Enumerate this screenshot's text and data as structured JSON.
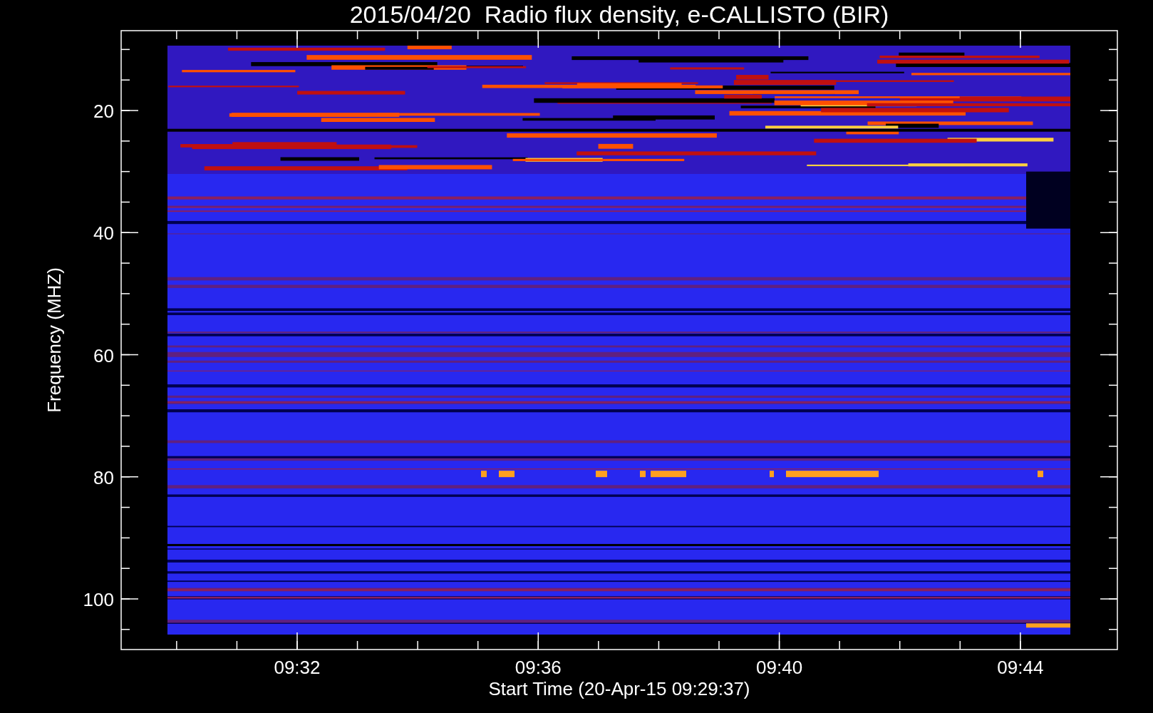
{
  "title": "2015/04/20  Radio flux density, e-CALLISTO (BIR)",
  "y_axis": {
    "label": "Frequency (MHZ)",
    "ticks": [
      "20",
      "40",
      "60",
      "80",
      "100"
    ]
  },
  "x_axis": {
    "label": "Start Time (20-Apr-15 09:29:37)",
    "ticks": [
      "09:32",
      "09:36",
      "09:40",
      "09:44"
    ]
  }
}
